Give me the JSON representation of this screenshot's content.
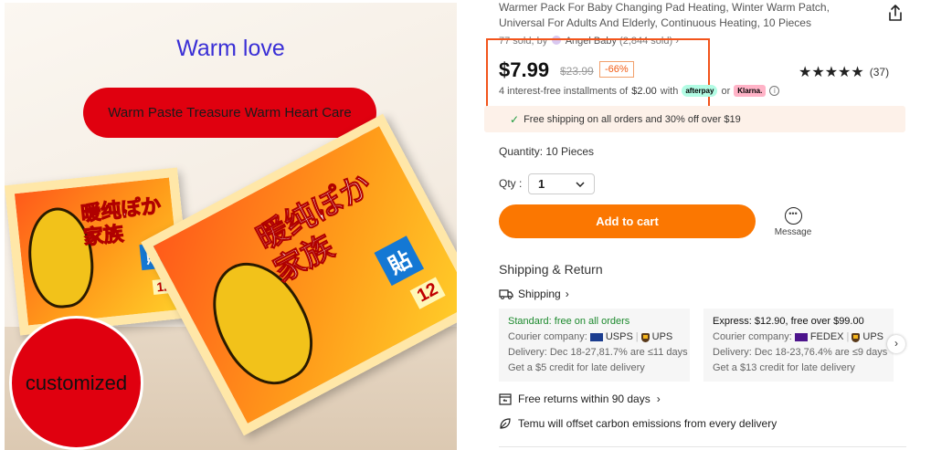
{
  "product_image": {
    "headline": "Warm love",
    "banner": "Warm Paste Treasure Warm Heart Care",
    "badge": "customized",
    "pack_brand_text": "暖纯ぽか家族",
    "pack_tag": "貼",
    "pack_count": "12"
  },
  "product": {
    "title": "Warmer Pack For Baby Changing Pad Heating, Winter Warm Patch, Universal For Adults And Elderly, Continuous Heating, 10 Pieces",
    "sold_line": "77 sold, by",
    "store_name": "Angel Baby",
    "store_sold": "(2,844 sold)",
    "store_chevron": "›",
    "price": "$7.99",
    "old_price": "$23.99",
    "discount": "-66%",
    "rating_stars": "★★★★★",
    "rating_count": "(37)",
    "installments_text": "4 interest-free installments of",
    "installments_amount": "$2.00",
    "installments_with": "with",
    "afterpay_label": "afterpay",
    "or_label": "or",
    "klarna_label": "Klarna.",
    "info_icon": "i",
    "free_shipping_banner": "Free shipping on all orders and 30% off over $19",
    "quantity_text": "Quantity: 10 Pieces",
    "qty_label": "Qty :",
    "qty_value": "1",
    "add_to_cart": "Add to cart",
    "message_label": "Message"
  },
  "shipping": {
    "section_title": "Shipping & Return",
    "link_label": "Shipping",
    "link_chevron": "›",
    "standard": {
      "title": "Standard: free on all orders",
      "courier_label": "Courier company:",
      "carrier1": "USPS",
      "carrier2": "UPS",
      "delivery": "Delivery: Dec 18-27,81.7% are ≤11 days",
      "credit": "Get a $5 credit for late delivery"
    },
    "express": {
      "title": "Express: $12.90, free over $99.00",
      "courier_label": "Courier company:",
      "carrier1": "FEDEX",
      "carrier2": "UPS",
      "delivery": "Delivery: Dec 18-23,76.4% are ≤9 days",
      "credit": "Get a $13 credit for late delivery"
    },
    "next_arrow": "›",
    "returns": "Free returns within 90 days",
    "returns_chevron": "›",
    "carbon": "Temu will offset carbon emissions from every delivery"
  },
  "colors": {
    "accent": "#fb7701",
    "highlight_border": "#f2541b",
    "discount": "#f25c14",
    "green": "#1d9a3e",
    "banner_bg": "#fdf1e9"
  }
}
